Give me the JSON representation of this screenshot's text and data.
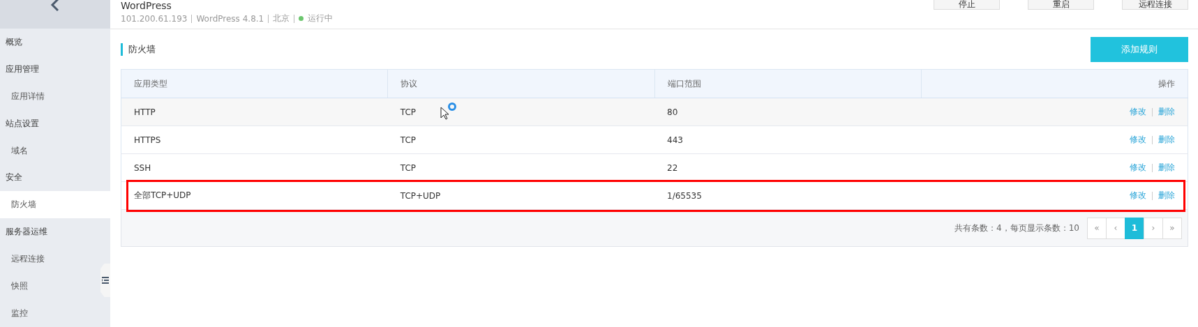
{
  "sidebar": {
    "items": [
      {
        "label": "概览",
        "kind": "group",
        "selected": false
      },
      {
        "label": "应用管理",
        "kind": "group",
        "selected": false
      },
      {
        "label": "应用详情",
        "kind": "item",
        "selected": false
      },
      {
        "label": "站点设置",
        "kind": "group",
        "selected": false
      },
      {
        "label": "域名",
        "kind": "item",
        "selected": false
      },
      {
        "label": "安全",
        "kind": "group",
        "selected": false
      },
      {
        "label": "防火墙",
        "kind": "item",
        "selected": true
      },
      {
        "label": "服务器运维",
        "kind": "group",
        "selected": false
      },
      {
        "label": "远程连接",
        "kind": "item",
        "selected": false
      },
      {
        "label": "快照",
        "kind": "item",
        "selected": false
      },
      {
        "label": "监控",
        "kind": "item",
        "selected": false
      }
    ]
  },
  "header": {
    "title": "WordPress",
    "ip": "101.200.61.193",
    "app": "WordPress 4.8.1",
    "region": "北京",
    "status": "运行中",
    "buttons": [
      "停止",
      "重启",
      "远程连接"
    ]
  },
  "section": {
    "title": "防火墙",
    "add_button": "添加规则"
  },
  "table": {
    "columns": [
      "应用类型",
      "协议",
      "端口范围",
      "操作"
    ],
    "rows": [
      {
        "cells": [
          "HTTP",
          "TCP",
          "80"
        ],
        "actions": [
          "修改",
          "删除"
        ],
        "hovered": true,
        "highlighted": false
      },
      {
        "cells": [
          "HTTPS",
          "TCP",
          "443"
        ],
        "actions": [
          "修改",
          "删除"
        ],
        "hovered": false,
        "highlighted": false
      },
      {
        "cells": [
          "SSH",
          "TCP",
          "22"
        ],
        "actions": [
          "修改",
          "删除"
        ],
        "hovered": false,
        "highlighted": false
      },
      {
        "cells": [
          "全部TCP+UDP",
          "TCP+UDP",
          "1/65535"
        ],
        "actions": [
          "修改",
          "删除"
        ],
        "hovered": false,
        "highlighted": true
      }
    ]
  },
  "pagination": {
    "summary": "共有条数：4，每页显示条数：10",
    "pages": [
      {
        "label": "«",
        "selected": false
      },
      {
        "label": "‹",
        "selected": false
      },
      {
        "label": "1",
        "selected": true
      },
      {
        "label": "›",
        "selected": false
      },
      {
        "label": "»",
        "selected": false
      }
    ]
  }
}
